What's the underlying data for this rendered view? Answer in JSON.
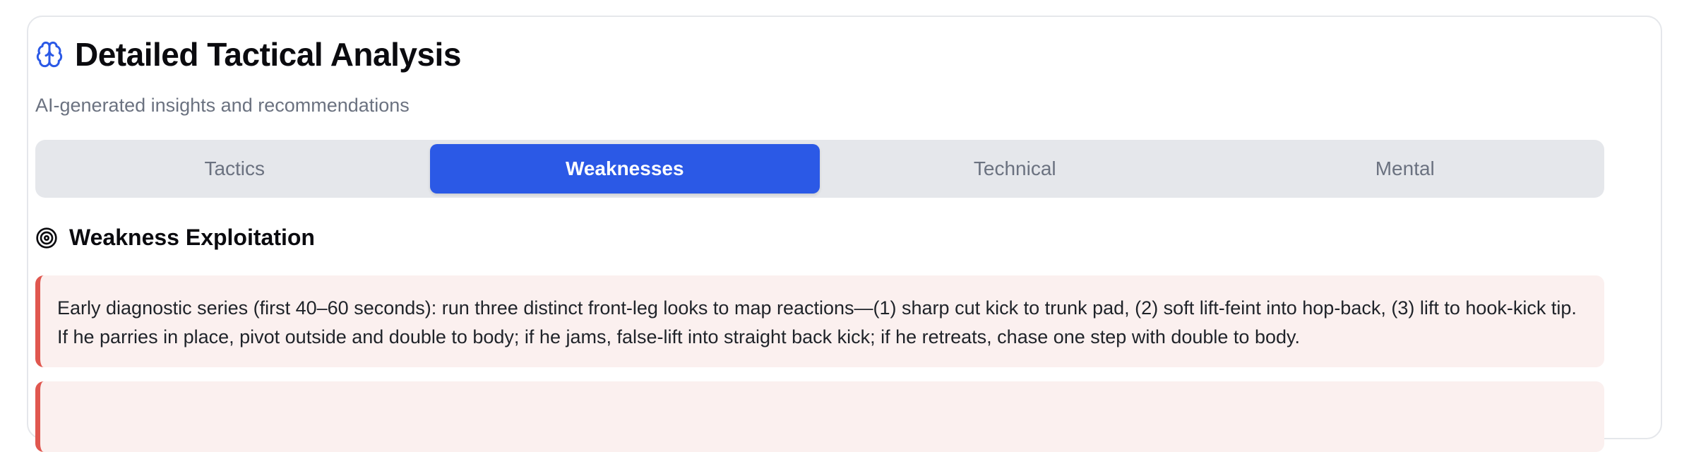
{
  "header": {
    "title": "Detailed Tactical Analysis",
    "subtitle": "AI-generated insights and recommendations",
    "icon": "brain-icon"
  },
  "tabs": [
    {
      "label": "Tactics",
      "active": false
    },
    {
      "label": "Weaknesses",
      "active": true
    },
    {
      "label": "Technical",
      "active": false
    },
    {
      "label": "Mental",
      "active": false
    }
  ],
  "section": {
    "title": "Weakness Exploitation",
    "icon": "target-icon"
  },
  "items": [
    {
      "text": "Early diagnostic series (first 40–60 seconds): run three distinct front-leg looks to map reactions—(1) sharp cut kick to trunk pad, (2) soft lift-feint into hop-back, (3) lift to hook-kick tip. If he parries in place, pivot outside and double to body; if he jams, false-lift into straight back kick; if he retreats, chase one step with double to body."
    },
    {
      "text": ""
    }
  ],
  "colors": {
    "accent": "#2b59e6",
    "card_border": "#e0574f",
    "card_bg": "#fbf0ef"
  }
}
